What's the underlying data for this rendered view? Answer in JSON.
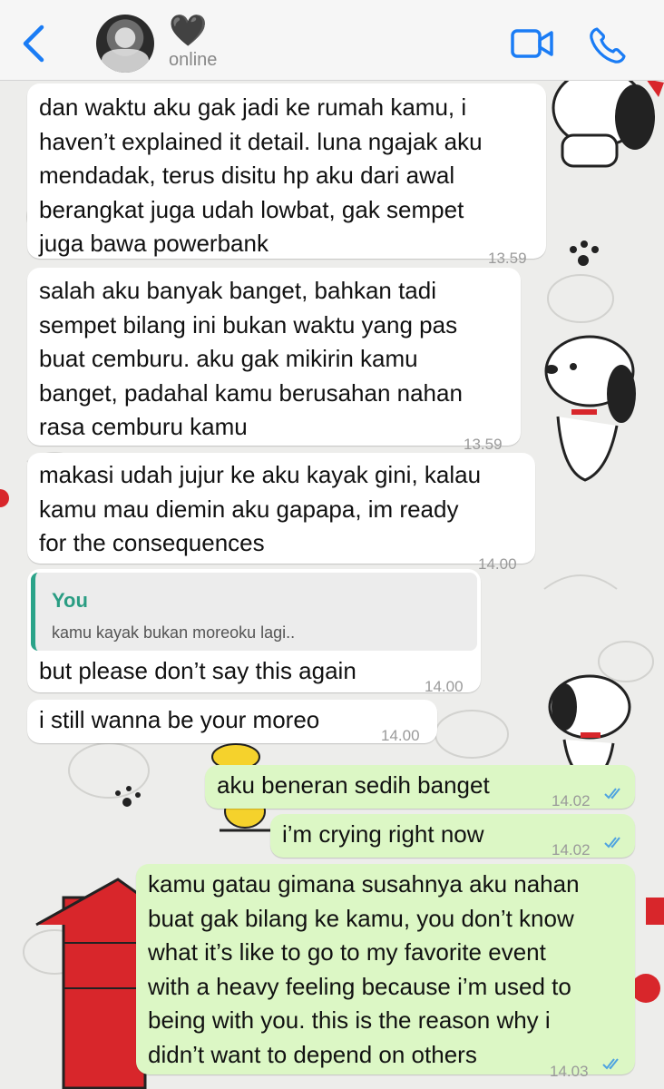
{
  "header": {
    "contact_name": "🖤",
    "status": "online",
    "back_icon": "chevron-left-icon",
    "video_icon": "video-camera-icon",
    "call_icon": "phone-icon",
    "accent": "#1a7cf5"
  },
  "messages": [
    {
      "direction": "in",
      "lines": [
        "dan waktu aku gak jadi ke rumah kamu, i",
        "haven’t explained it detail. luna ngajak aku",
        "mendadak, terus disitu hp aku dari awal",
        "berangkat juga udah lowbat, gak sempet",
        "juga bawa powerbank"
      ],
      "time": "13.59"
    },
    {
      "direction": "in",
      "lines": [
        "salah aku banyak banget, bahkan tadi",
        "sempet bilang ini bukan waktu yang pas",
        "buat cemburu. aku gak mikirin kamu",
        "banget, padahal kamu berusahan nahan",
        "rasa cemburu kamu"
      ],
      "time": "13.59"
    },
    {
      "direction": "in",
      "lines": [
        "makasi udah jujur ke aku kayak gini, kalau",
        "kamu mau diemin aku gapapa, im ready",
        "for the consequences"
      ],
      "time": "14.00"
    },
    {
      "direction": "in",
      "quote": {
        "author": "You",
        "text": "kamu kayak bukan moreoku lagi.."
      },
      "lines": [
        "but please don’t say this again"
      ],
      "time": "14.00"
    },
    {
      "direction": "in",
      "lines": [
        "i still wanna be your moreo"
      ],
      "time": "14.00"
    },
    {
      "direction": "out",
      "lines": [
        "aku beneran sedih banget"
      ],
      "time": "14.02",
      "status": "read"
    },
    {
      "direction": "out",
      "lines": [
        "i’m crying right now"
      ],
      "time": "14.02",
      "status": "read"
    },
    {
      "direction": "out",
      "lines": [
        "kamu gatau gimana susahnya aku nahan",
        "buat gak bilang ke kamu, you don’t know",
        "what it’s like to go to my favorite event",
        "with a heavy feeling because i’m used to",
        "being with you. this is the reason why i",
        "didn’t want to depend on others"
      ],
      "time": "14.03",
      "status": "read"
    }
  ],
  "colors": {
    "incoming_bubble": "#ffffff",
    "outgoing_bubble": "#dcf7c5",
    "read_ticks": "#4fa3e0",
    "quote_author": "#2a9d83"
  }
}
